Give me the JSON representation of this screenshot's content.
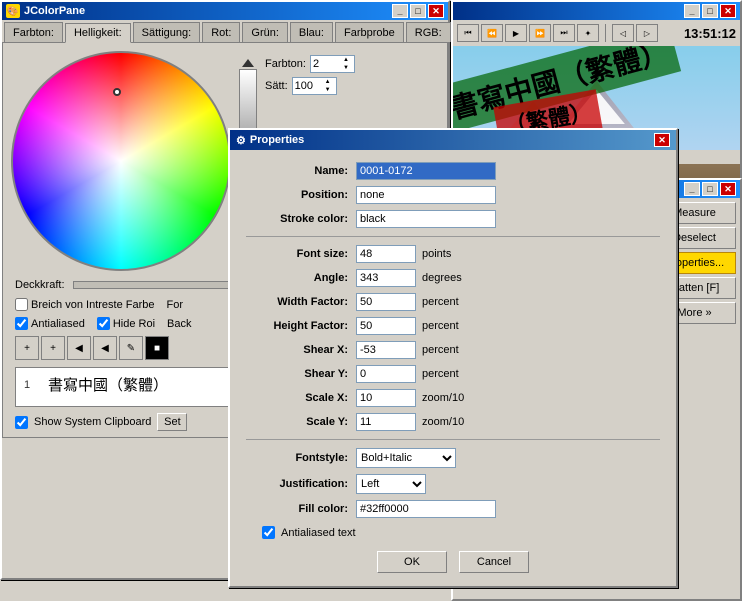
{
  "app": {
    "title": "JColorPane",
    "properties_title": "Properties"
  },
  "tabs": {
    "items": [
      {
        "label": "Farbton:",
        "active": false
      },
      {
        "label": "Helligkeit:",
        "active": true
      },
      {
        "label": "Sättigung:",
        "active": false
      },
      {
        "label": "Rot:",
        "active": false
      },
      {
        "label": "Grün:",
        "active": false
      },
      {
        "label": "Blau:",
        "active": false
      },
      {
        "label": "Farbprobe",
        "active": false
      },
      {
        "label": "RGB:",
        "active": false
      }
    ]
  },
  "color_controls": {
    "farbton_label": "Farbton:",
    "farbton_value": "2",
    "satt_label": "Sätt:",
    "satt_value": "100",
    "opacity_label": "Deckkraft:"
  },
  "checkboxes": {
    "breich": "Breich von Intreste Farbe",
    "for": "For",
    "antialiased": "Antialiased",
    "hide_roi": "Hide Roi",
    "back": "Back"
  },
  "toolbar": {
    "buttons": [
      "+",
      "+",
      "◀",
      "◀",
      "✎",
      "⬛"
    ]
  },
  "list": {
    "items": [
      {
        "num": "1",
        "text": "書寫中國（繁體）"
      }
    ]
  },
  "show_clipboard": {
    "label": "Show System Clipboard",
    "set_label": "Set"
  },
  "properties": {
    "title": "Properties",
    "fields": {
      "name_label": "Name:",
      "name_value": "0001-0172",
      "position_label": "Position:",
      "position_value": "none",
      "stroke_color_label": "Stroke color:",
      "stroke_color_value": "black",
      "font_size_label": "Font size:",
      "font_size_value": "48",
      "font_size_unit": "points",
      "angle_label": "Angle:",
      "angle_value": "343",
      "angle_unit": "degrees",
      "width_factor_label": "Width Factor:",
      "width_factor_value": "50",
      "width_factor_unit": "percent",
      "height_factor_label": "Height Factor:",
      "height_factor_value": "50",
      "height_factor_unit": "percent",
      "shear_x_label": "Shear X:",
      "shear_x_value": "-53",
      "shear_x_unit": "percent",
      "shear_y_label": "Shear Y:",
      "shear_y_value": "0",
      "shear_y_unit": "percent",
      "scale_x_label": "Scale X:",
      "scale_x_value": "10",
      "scale_x_unit": "zoom/10",
      "scale_y_label": "Scale Y:",
      "scale_y_value": "11",
      "scale_y_unit": "zoom/10",
      "fontstyle_label": "Fontstyle:",
      "fontstyle_value": "Bold+Italic",
      "justification_label": "Justification:",
      "justification_value": "Left",
      "fill_color_label": "Fill color:",
      "fill_color_value": "#32ff0000",
      "antialiased_label": "Antialiased text"
    },
    "buttons": {
      "ok": "OK",
      "cancel": "Cancel"
    }
  },
  "sidebar_buttons": {
    "measure": "Measure",
    "deselect": "Deselect",
    "properties": "Properties...",
    "flatten": "Flatten [F]",
    "more": "More »"
  },
  "clock": "13:51:12",
  "media_controls": [
    "⏮",
    "⏪",
    "▶",
    "⏩",
    "⏭",
    "✦"
  ],
  "photo_texts": {
    "green_text": "書寫中國（繁體）",
    "red_text": "（繁體）",
    "bottom_text": "繁體）"
  }
}
